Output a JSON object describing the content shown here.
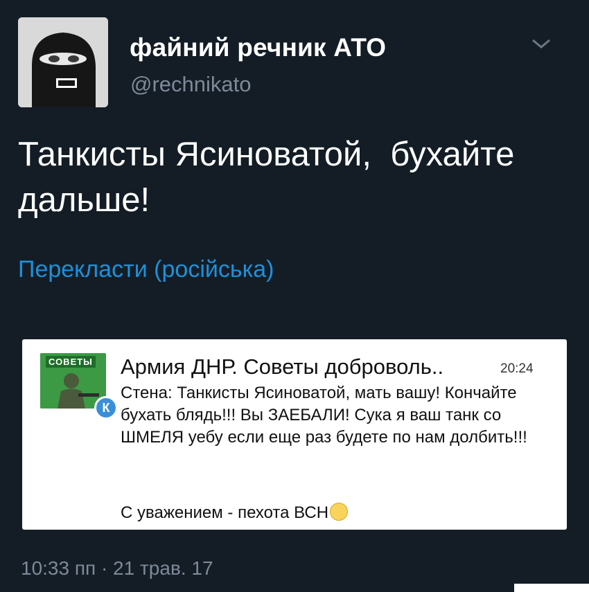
{
  "author": {
    "display_name": "файний речник АТО",
    "handle": "@rechnikato",
    "avatar_icon": "balaclava-avatar"
  },
  "tweet": {
    "text": "Танкисты Ясиноватой,  бухайте дальше!",
    "translate_label": "Перекласти (російська)",
    "timestamp": "10:33 пп · 21 трав. 17"
  },
  "quoted_card": {
    "avatar_banner": "СОВЕТЫ",
    "badge_letter": "К",
    "title": "Армия ДНР. Советы доброволь..",
    "time": "20:24",
    "body": "Стена: Танкисты Ясиноватой, мать вашу! Кончайте бухать блядь!!! Вы ЗАЕБАЛИ! Сука я ваш танк со ШМЕЛЯ уебу если еще раз будете по нам долбить!!!",
    "signature": "С уважением - пехота ВСН"
  },
  "colors": {
    "background": "#141d26",
    "link": "#1d91d9",
    "muted": "#7d8a98",
    "card_bg": "#ffffff"
  }
}
